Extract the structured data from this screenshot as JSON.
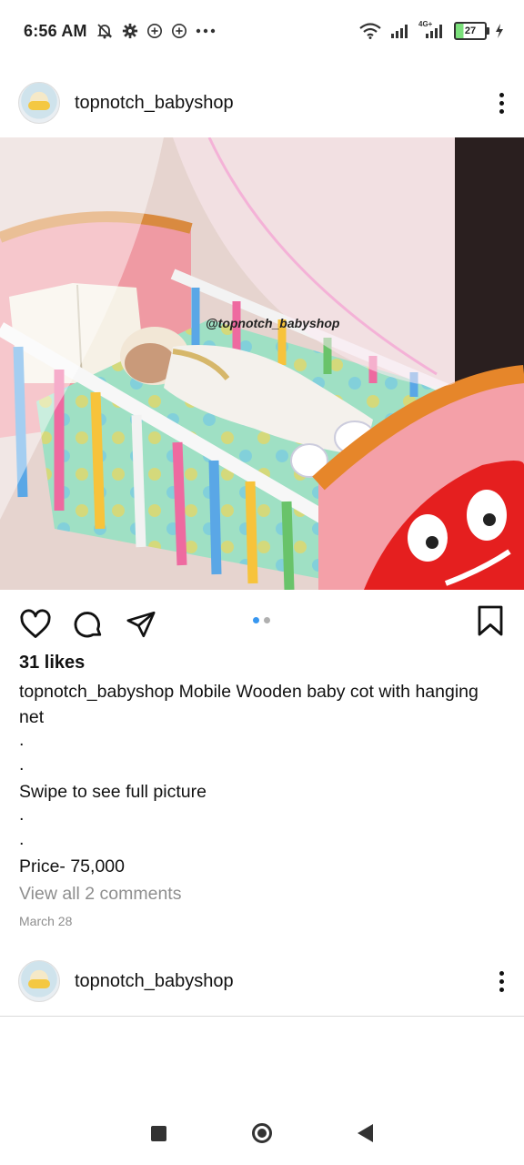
{
  "status_bar": {
    "time": "6:56 AM",
    "left_icons": [
      "muted-bell-icon",
      "gear-icon",
      "plus-circle-icon",
      "plus-circle-icon",
      "more-dots-icon"
    ],
    "right_icons": [
      "wifi-icon",
      "signal-icon",
      "signal-4g-icon",
      "battery-icon",
      "charging-icon"
    ],
    "network_label": "4G+",
    "battery_level": "27"
  },
  "post": {
    "username": "topnotch_babyshop",
    "image_watermark": "@topnotch_babyshop",
    "carousel": {
      "count": 2,
      "active_index": 0,
      "active_color": "#3897f0",
      "inactive_color": "#b0b0b0"
    },
    "likes": "31 likes",
    "caption": {
      "username": "topnotch_babyshop",
      "text": "Mobile Wooden baby cot with hanging net",
      "line_dot_1": ".",
      "line_dot_2": ".",
      "line_swipe": "Swipe to see full picture",
      "line_dot_3": ".",
      "line_dot_4": ".",
      "line_price": "Price- 75,000"
    },
    "comments_link": "View all 2 comments",
    "date": "March 28"
  },
  "next_post": {
    "username": "topnotch_babyshop"
  },
  "colors": {
    "text": "#111111",
    "muted": "#8e8e8e",
    "divider": "#dbdbdb"
  }
}
